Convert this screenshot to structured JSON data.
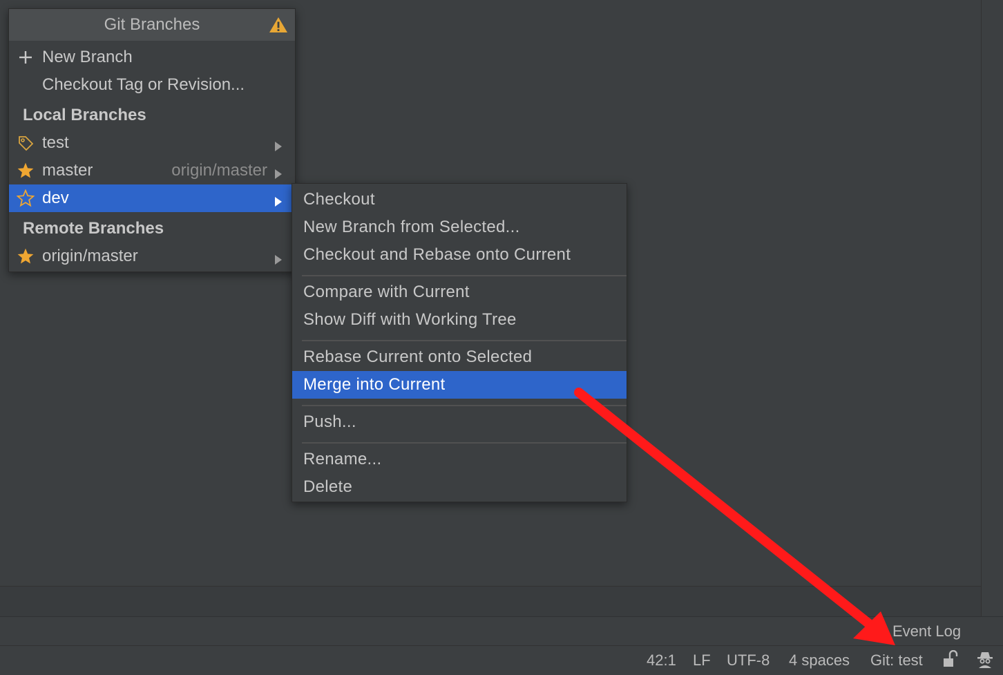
{
  "popup": {
    "title": "Git Branches",
    "actions": [
      {
        "label": "New Branch",
        "icon": "plus-icon"
      },
      {
        "label": "Checkout Tag or Revision...",
        "icon": ""
      }
    ],
    "local_header": "Local Branches",
    "local_branches": [
      {
        "name": "test",
        "icon": "tag-icon",
        "tracking": ""
      },
      {
        "name": "master",
        "icon": "star-filled-icon",
        "tracking": "origin/master"
      },
      {
        "name": "dev",
        "icon": "star-outline-icon",
        "tracking": "",
        "selected": true
      }
    ],
    "remote_header": "Remote Branches",
    "remote_branches": [
      {
        "name": "origin/master",
        "icon": "star-filled-icon"
      }
    ]
  },
  "submenu": {
    "items": [
      "Checkout",
      "New Branch from Selected...",
      "Checkout and Rebase onto Current",
      "Compare with Current",
      "Show Diff with Working Tree",
      "Rebase Current onto Selected",
      "Merge into Current",
      "Push...",
      "Rename...",
      "Delete"
    ],
    "selected": "Merge into Current"
  },
  "toolwindow": {
    "event_log": "Event Log"
  },
  "status_bar": {
    "position": "42:1",
    "line_separator": "LF",
    "encoding": "UTF-8",
    "indent": "4 spaces",
    "vcs_branch": "Git: test"
  },
  "colors": {
    "background": "#3c3f41",
    "selection": "#2e65ca",
    "star": "#f0a732",
    "annotation_arrow": "#ff1a1a"
  }
}
